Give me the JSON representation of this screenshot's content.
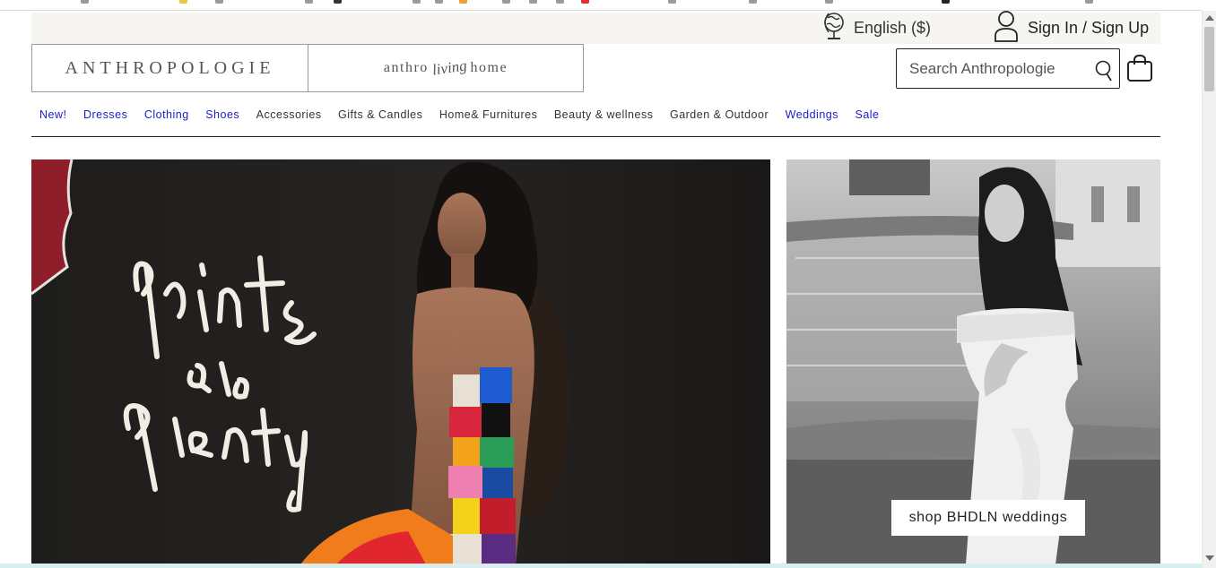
{
  "header": {
    "language": "English ($)",
    "sign_in": "Sign In / Sign Up"
  },
  "logos": {
    "anthropologie": "ANTHROPOLOGIE",
    "living_left": "anthro",
    "living_script": "living",
    "living_right": "home"
  },
  "search": {
    "placeholder": "Search Anthropologie"
  },
  "nav": {
    "items": [
      {
        "label": "New!",
        "color": "#1c1cc8"
      },
      {
        "label": "Dresses",
        "color": "#1c1cc8"
      },
      {
        "label": "Clothing",
        "color": "#1c1cc8"
      },
      {
        "label": "Shoes",
        "color": "#1c1cc8"
      },
      {
        "label": "Accessories",
        "color": "#333333"
      },
      {
        "label": "Gifts & Candles",
        "color": "#333333"
      },
      {
        "label": "Home& Furnitures",
        "color": "#333333"
      },
      {
        "label": "Beauty & wellness",
        "color": "#333333"
      },
      {
        "label": "Garden & Outdoor",
        "color": "#333333"
      },
      {
        "label": "Weddings",
        "color": "#1c1cc8"
      },
      {
        "label": "Sale",
        "color": "#1c1cc8"
      }
    ]
  },
  "hero": {
    "left_script_1": "prints",
    "left_script_2": "à la",
    "left_script_3": "plenty",
    "right_cta": "shop BHDLN weddings"
  }
}
